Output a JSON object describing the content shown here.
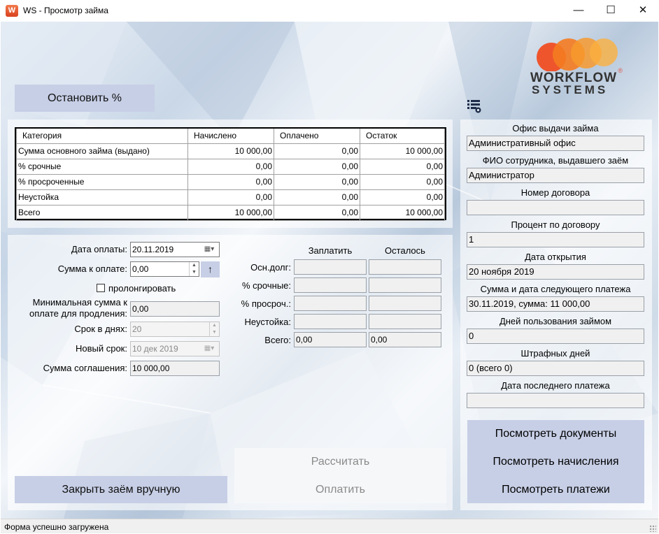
{
  "window": {
    "title": "WS - Просмотр займа",
    "minimize": "—",
    "maximize": "☐",
    "close": "✕"
  },
  "logo": {
    "line1": "WORKFLOW",
    "line2": "SYSTEMS",
    "mark": "®"
  },
  "stop_button": "Остановить %",
  "table": {
    "headers": [
      "Категория",
      "Начислено",
      "Оплачено",
      "Остаток"
    ],
    "rows": [
      [
        "Сумма основного займа (выдано)",
        "10 000,00",
        "0,00",
        "10 000,00"
      ],
      [
        "% срочные",
        "0,00",
        "0,00",
        "0,00"
      ],
      [
        "% просроченные",
        "0,00",
        "0,00",
        "0,00"
      ],
      [
        "Неустойка",
        "0,00",
        "0,00",
        "0,00"
      ],
      [
        "Всего",
        "10 000,00",
        "0,00",
        "10 000,00"
      ]
    ]
  },
  "payment": {
    "date_label": "Дата оплаты:",
    "date_value": "20.11.2019",
    "amount_label": "Сумма к оплате:",
    "amount_value": "0,00",
    "up_button": "↑",
    "prolong_label": "пролонгировать",
    "min_sum_label_1": "Минимальная сумма к",
    "min_sum_label_2": "оплате для продления:",
    "min_sum_value": "0,00",
    "term_label": "Срок в днях:",
    "term_value": "20",
    "new_term_label": "Новый срок:",
    "new_term_value": "10 дек 2019",
    "agreement_label": "Сумма соглашения:",
    "agreement_value": "10 000,00"
  },
  "breakdown": {
    "col_pay": "Заплатить",
    "col_left": "Осталось",
    "rows": [
      {
        "label": "Осн.долг:",
        "pay": "",
        "left": ""
      },
      {
        "label": "% срочные:",
        "pay": "",
        "left": ""
      },
      {
        "label": "% просроч.:",
        "pay": "",
        "left": ""
      },
      {
        "label": "Неустойка:",
        "pay": "",
        "left": ""
      },
      {
        "label": "Всего:",
        "pay": "0,00",
        "left": "0,00"
      }
    ]
  },
  "actions": {
    "calculate": "Рассчитать",
    "pay": "Оплатить",
    "close_manual": "Закрыть заём вручную"
  },
  "info": {
    "office_label": "Офис выдачи займа",
    "office_value": "Административный офис",
    "employee_label": "ФИО сотрудника, выдавшего заём",
    "employee_value": "Администратор",
    "contract_label": "Номер договора",
    "contract_value": "",
    "rate_label": "Процент по договору",
    "rate_value": "1",
    "open_date_label": "Дата открытия",
    "open_date_value": "20 ноября 2019",
    "next_payment_label": "Сумма и дата следующего платежа",
    "next_payment_value": "30.11.2019, сумма: 11 000,00",
    "days_label": "Дней пользования займом",
    "days_value": "0",
    "penalty_days_label": "Штрафных дней",
    "penalty_days_value": "0 (всего 0)",
    "last_payment_label": "Дата последнего платежа",
    "last_payment_value": ""
  },
  "side_buttons": {
    "documents": "Посмотреть документы",
    "accruals": "Посмотреть начисления",
    "payments": "Посмотреть платежи"
  },
  "status": "Форма успешно загружена",
  "icons": {
    "settings": "list-gear-icon",
    "calendar": "calendar-icon",
    "checkbox": "checkbox-icon"
  }
}
